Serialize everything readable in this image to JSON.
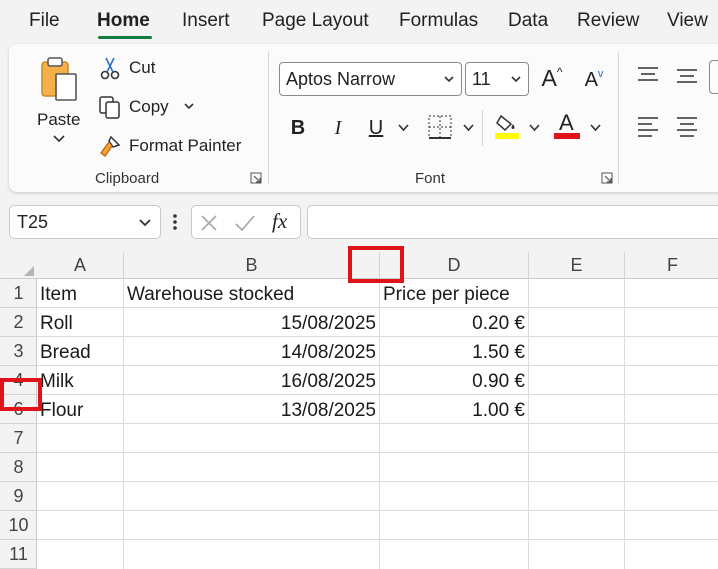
{
  "tabs": [
    {
      "label": "File"
    },
    {
      "label": "Home"
    },
    {
      "label": "Insert"
    },
    {
      "label": "Page Layout"
    },
    {
      "label": "Formulas"
    },
    {
      "label": "Data"
    },
    {
      "label": "Review"
    },
    {
      "label": "View"
    }
  ],
  "ribbon": {
    "clipboard": {
      "paste_label": "Paste",
      "cut_label": "Cut",
      "copy_label": "Copy",
      "format_painter_label": "Format Painter",
      "group_label": "Clipboard"
    },
    "font": {
      "font_name": "Aptos Narrow",
      "font_size": "11",
      "bold": "B",
      "italic": "I",
      "underline": "U",
      "grow_label": "A",
      "shrink_label": "A",
      "font_color_label": "A",
      "group_label": "Font"
    }
  },
  "formula_bar": {
    "name_box": "T25",
    "fx_label": "fx",
    "formula": ""
  },
  "grid": {
    "columns": [
      "A",
      "B",
      "D",
      "E",
      "F"
    ],
    "rows": [
      "1",
      "2",
      "3",
      "4",
      "6",
      "7",
      "8",
      "9",
      "10",
      "11"
    ],
    "cells": [
      [
        "Item",
        "Warehouse stocked",
        "Price per piece"
      ],
      [
        "Roll",
        "15/08/2025",
        "0.20 €"
      ],
      [
        "Bread",
        "14/08/2025",
        "1.50 €"
      ],
      [
        "Milk",
        "16/08/2025",
        "0.90 €"
      ],
      [
        "Flour",
        "13/08/2025",
        "1.00 €"
      ]
    ]
  },
  "colors": {
    "accent": "#107c41",
    "highlight": "#e0121c",
    "fill_yellow": "#ffff00",
    "font_red": "#e0121c"
  }
}
